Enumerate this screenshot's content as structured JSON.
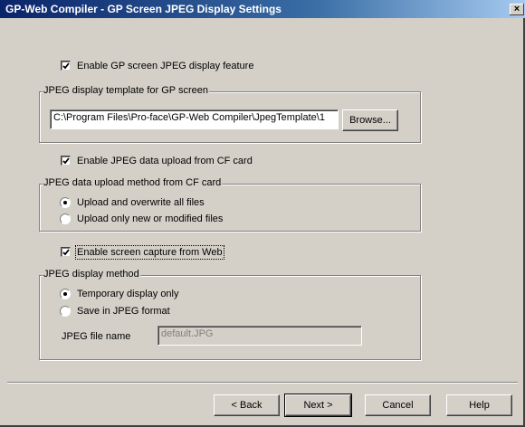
{
  "window": {
    "title": "GP-Web Compiler - GP Screen JPEG Display Settings",
    "close_glyph": "×"
  },
  "enable_jpeg_display": {
    "label": "Enable GP screen JPEG display feature",
    "checked": true
  },
  "template_group": {
    "legend": "JPEG display template for GP screen",
    "path_value": "C:\\Program Files\\Pro-face\\GP-Web Compiler\\JpegTemplate\\1",
    "browse_label": "Browse..."
  },
  "enable_cf_upload": {
    "label": "Enable JPEG data upload from CF card",
    "checked": true
  },
  "upload_method_group": {
    "legend": "JPEG data upload method from CF card",
    "options": [
      {
        "label": "Upload and overwrite all files",
        "selected": true
      },
      {
        "label": "Upload only new or modified files",
        "selected": false
      }
    ]
  },
  "enable_screen_capture": {
    "label": "Enable screen capture from Web",
    "checked": true
  },
  "display_method_group": {
    "legend": "JPEG display method",
    "options": [
      {
        "label": "Temporary display only",
        "selected": true
      },
      {
        "label": "Save in JPEG format",
        "selected": false
      }
    ],
    "file_name_label": "JPEG file name",
    "file_name_value": "default.JPG"
  },
  "buttons": {
    "back": "< Back",
    "next": "Next >",
    "cancel": "Cancel",
    "help": "Help"
  }
}
